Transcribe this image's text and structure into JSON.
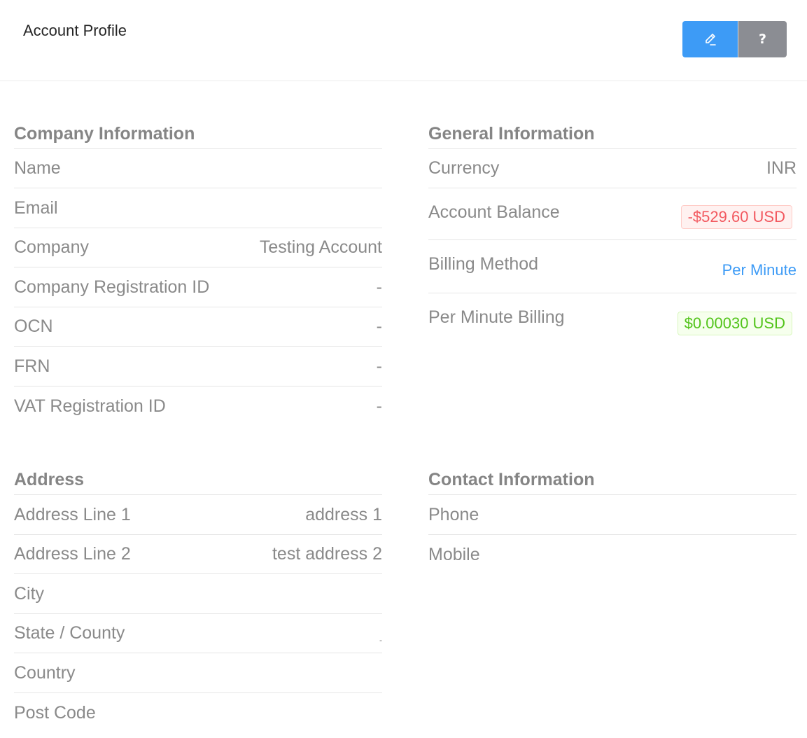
{
  "header": {
    "title": "Account Profile",
    "edit_icon": "pencil-icon",
    "help_label": "?"
  },
  "company": {
    "title": "Company Information",
    "rows": [
      {
        "label": "Name",
        "value": ""
      },
      {
        "label": "Email",
        "value": ""
      },
      {
        "label": "Company",
        "value": "Testing Account"
      },
      {
        "label": "Company Registration ID",
        "value": "-"
      },
      {
        "label": "OCN",
        "value": "-"
      },
      {
        "label": "FRN",
        "value": "-"
      },
      {
        "label": "VAT Registration ID",
        "value": "-"
      }
    ]
  },
  "general": {
    "title": "General Information",
    "currency_label": "Currency",
    "currency_value": "INR",
    "balance_label": "Account Balance",
    "balance_value": "-$529.60 USD",
    "billing_method_label": "Billing Method",
    "billing_method_value": "Per Minute",
    "per_minute_label": "Per Minute Billing",
    "per_minute_value": "$0.00030 USD"
  },
  "address": {
    "title": "Address",
    "rows": [
      {
        "label": "Address Line 1",
        "value": "address 1"
      },
      {
        "label": "Address Line 2",
        "value": "test address 2"
      },
      {
        "label": "City",
        "value": ""
      },
      {
        "label": "State / County",
        "value": "-"
      },
      {
        "label": "Country",
        "value": ""
      },
      {
        "label": "Post Code",
        "value": ""
      }
    ]
  },
  "contact": {
    "title": "Contact Information",
    "rows": [
      {
        "label": "Phone",
        "value": ""
      },
      {
        "label": "Mobile",
        "value": ""
      }
    ]
  },
  "colors": {
    "primary": "#3d9bf6",
    "secondary": "#8b8d93",
    "danger": "#f2585f",
    "success": "#52c41a"
  }
}
